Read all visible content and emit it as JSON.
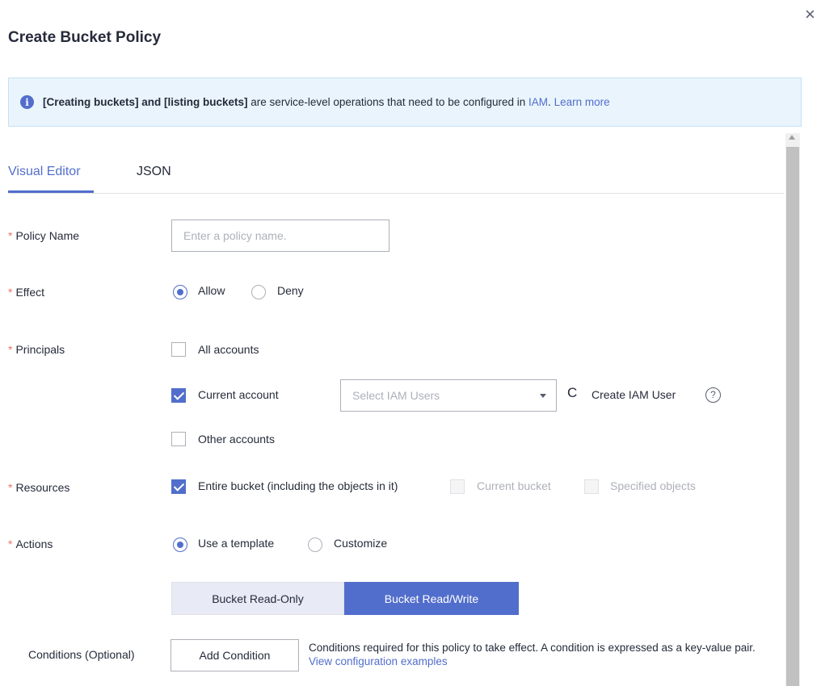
{
  "dialog": {
    "title": "Create Bucket Policy",
    "close_glyph": "×"
  },
  "notice": {
    "icon": "info-icon",
    "bold_text": "[Creating buckets] and [listing buckets]",
    "text": " are service-level operations that need to be configured in ",
    "iam_link": "IAM",
    "period": ".",
    "learn_more": "Learn more"
  },
  "tabs": [
    {
      "label": "Visual Editor",
      "active": true
    },
    {
      "label": "JSON",
      "active": false
    }
  ],
  "required_mark": "*",
  "policy_name": {
    "label": "Policy Name",
    "value": "",
    "placeholder": "Enter a policy name."
  },
  "effect": {
    "label": "Effect",
    "options": [
      {
        "label": "Allow",
        "selected": true
      },
      {
        "label": "Deny",
        "selected": false
      }
    ]
  },
  "principals": {
    "label": "Principals",
    "all_accounts": {
      "label": "All accounts",
      "checked": false
    },
    "current_account": {
      "label": "Current account",
      "checked": true
    },
    "iam_users_select": {
      "placeholder": "Select IAM Users"
    },
    "create_iam_user": "Create IAM User",
    "help_glyph": "?",
    "refresh_glyph": "C",
    "other_accounts": {
      "label": "Other accounts",
      "checked": false
    }
  },
  "resources": {
    "label": "Resources",
    "entire_bucket": {
      "label": "Entire bucket (including the objects in it)",
      "checked": true
    },
    "current_bucket": {
      "label": "Current bucket",
      "checked": false,
      "disabled": true
    },
    "specified_objects": {
      "label": "Specified objects",
      "checked": false,
      "disabled": true
    }
  },
  "actions": {
    "label": "Actions",
    "options": [
      {
        "label": "Use a template",
        "selected": true
      },
      {
        "label": "Customize",
        "selected": false
      }
    ],
    "templates": [
      {
        "label": "Bucket Read-Only",
        "selected": false
      },
      {
        "label": "Bucket Read/Write",
        "selected": true
      }
    ]
  },
  "conditions": {
    "label": "Conditions (Optional)",
    "button": "Add Condition",
    "description": "Conditions required for this policy to take effect. A condition is expressed as a key-value pair.",
    "link": "View configuration examples"
  },
  "colors": {
    "accent": "#526ecc",
    "required": "#f66f6a",
    "notice_bg": "#e9f4fc"
  }
}
